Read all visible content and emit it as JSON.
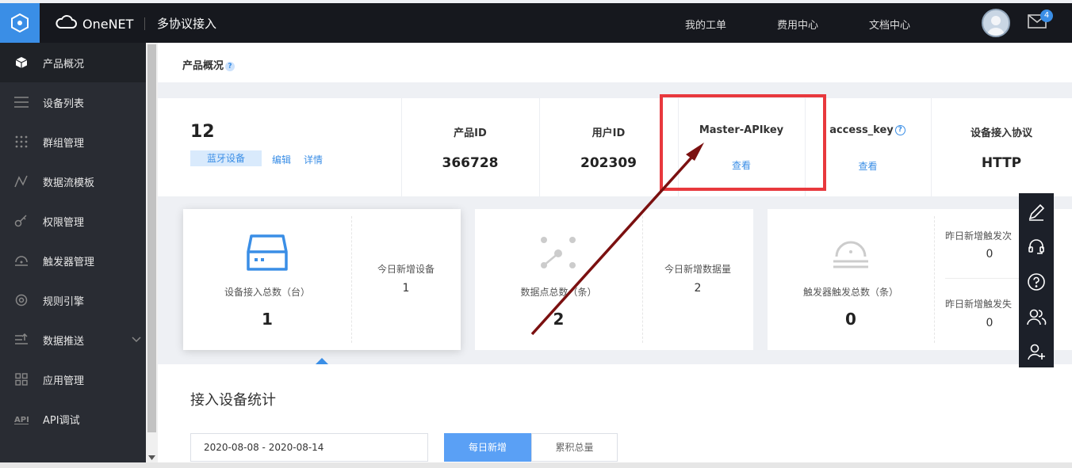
{
  "header": {
    "brand": "OneNET",
    "module": "多协议接入",
    "nav": [
      "我的工单",
      "费用中心",
      "文档中心"
    ],
    "mail_count": "4"
  },
  "sidebar": {
    "items": [
      {
        "label": "产品概况",
        "icon": "cube-icon"
      },
      {
        "label": "设备列表",
        "icon": "list-icon"
      },
      {
        "label": "群组管理",
        "icon": "grid-dots-icon"
      },
      {
        "label": "数据流模板",
        "icon": "stream-icon"
      },
      {
        "label": "权限管理",
        "icon": "key-icon"
      },
      {
        "label": "触发器管理",
        "icon": "trigger-icon"
      },
      {
        "label": "规则引擎",
        "icon": "rule-icon"
      },
      {
        "label": "数据推送",
        "icon": "push-icon"
      },
      {
        "label": "应用管理",
        "icon": "apps-icon"
      },
      {
        "label": "API调试",
        "icon": "api-icon"
      }
    ]
  },
  "page": {
    "crumb": "产品概况",
    "help": "?"
  },
  "product": {
    "count": "12",
    "tag": "蓝牙设备",
    "edit": "编辑",
    "detail": "详情",
    "fields": {
      "product_id_label": "产品ID",
      "product_id": "366728",
      "user_id_label": "用户ID",
      "user_id": "202309",
      "master_apikey_label": "Master-APIkey",
      "master_apikey_link": "查看",
      "access_key_label": "access_key",
      "access_key_link": "查看",
      "protocol_label": "设备接入协议",
      "protocol": "HTTP"
    }
  },
  "stats": {
    "devices": {
      "label": "设备接入总数（台）",
      "value": "1",
      "today_label": "今日新增设备",
      "today_value": "1"
    },
    "datapoints": {
      "label": "数据点总数（条）",
      "value": "2",
      "today_label": "今日新增数据量",
      "today_value": "2"
    },
    "triggers": {
      "label": "触发器触发总数（条）",
      "value": "0",
      "y1_label": "昨日新增触发次",
      "y1_value": "0",
      "y2_label": "昨日新增触发失",
      "y2_value": "0"
    }
  },
  "section": {
    "title": "接入设备统计",
    "date_range": "2020-08-08 - 2020-08-14",
    "daily": "每日新增",
    "total": "累积总量"
  },
  "colors": {
    "accent": "#3a8ee6",
    "annotation": "#e8383d",
    "arrow": "#7b1010"
  }
}
